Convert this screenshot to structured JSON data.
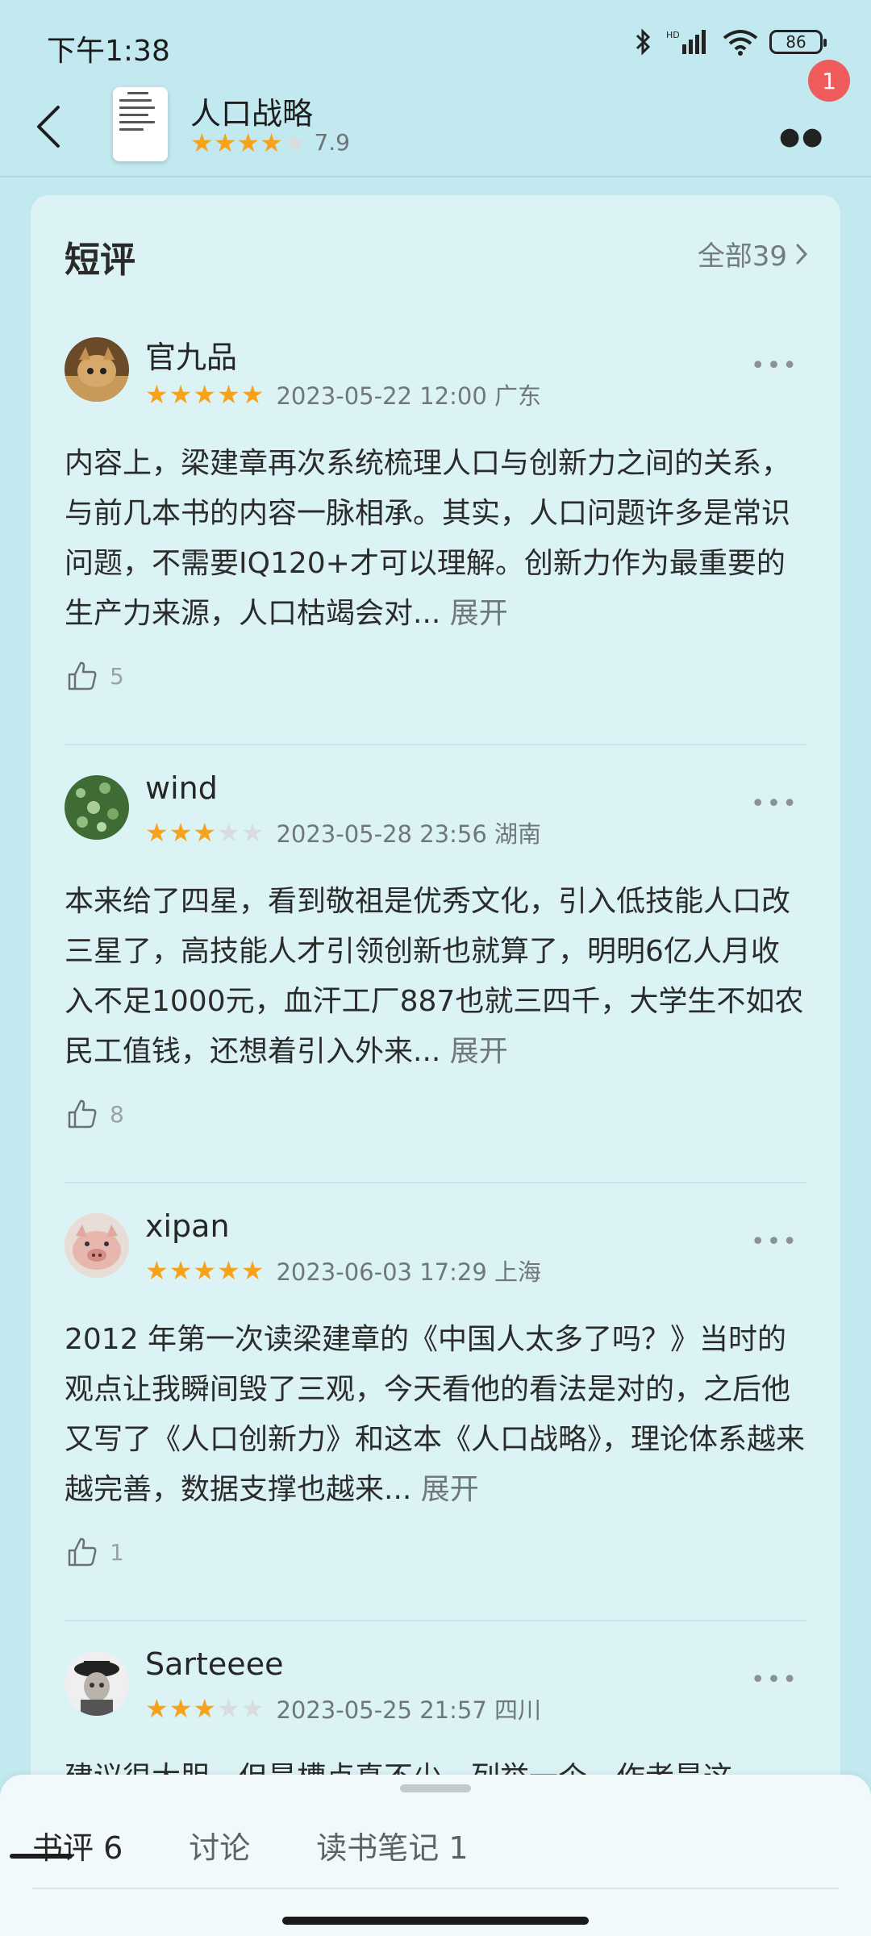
{
  "status": {
    "time": "下午1:38",
    "battery": "86"
  },
  "header": {
    "title": "人口战略",
    "rating_value": "7.9",
    "rating_stars": 4,
    "badge_count": "1"
  },
  "section": {
    "title": "短评",
    "all_label": "全部39"
  },
  "reviews": [
    {
      "user": "官九品",
      "stars": 5,
      "date": "2023-05-22 12:00 广东",
      "text": "内容上，梁建章再次系统梳理人口与创新力之间的关系，与前几本书的内容一脉相承。其实，人口问题许多是常识问题，不需要IQ120+才可以理解。创新力作为最重要的生产力来源，人口枯竭会对...",
      "expand": "展开",
      "likes": "5"
    },
    {
      "user": "wind",
      "stars": 3,
      "date": "2023-05-28 23:56 湖南",
      "text": "本来给了四星，看到敬祖是优秀文化，引入低技能人口改三星了，高技能人才引领创新也就算了，明明6亿人月收入不足1000元，血汗工厂887也就三四千，大学生不如农民工值钱，还想着引入外来...",
      "expand": "展开",
      "likes": "8"
    },
    {
      "user": "xipan",
      "stars": 5,
      "date": "2023-06-03 17:29 上海",
      "text": "2012 年第一次读梁建章的《中国人太多了吗？》当时的观点让我瞬间毁了三观，今天看他的看法是对的，之后他又写了《人口创新力》和这本《人口战略》，理论体系越来越完善，数据支撑也越来...",
      "expand": "展开",
      "likes": "1"
    },
    {
      "user": "Sarteeee",
      "stars": 3,
      "date": "2023-05-25 21:57 四川",
      "text": "建议很大胆，但是槽点真不少，列举一个，作者是这",
      "expand": "",
      "likes": ""
    }
  ],
  "tabs": [
    {
      "label": "书评 6"
    },
    {
      "label": "讨论"
    },
    {
      "label": "读书笔记 1"
    }
  ],
  "colors": {
    "star": "#f7a21b",
    "badge": "#f05b5b",
    "background": "#c2e9ef",
    "card": "#dcf3f5"
  }
}
